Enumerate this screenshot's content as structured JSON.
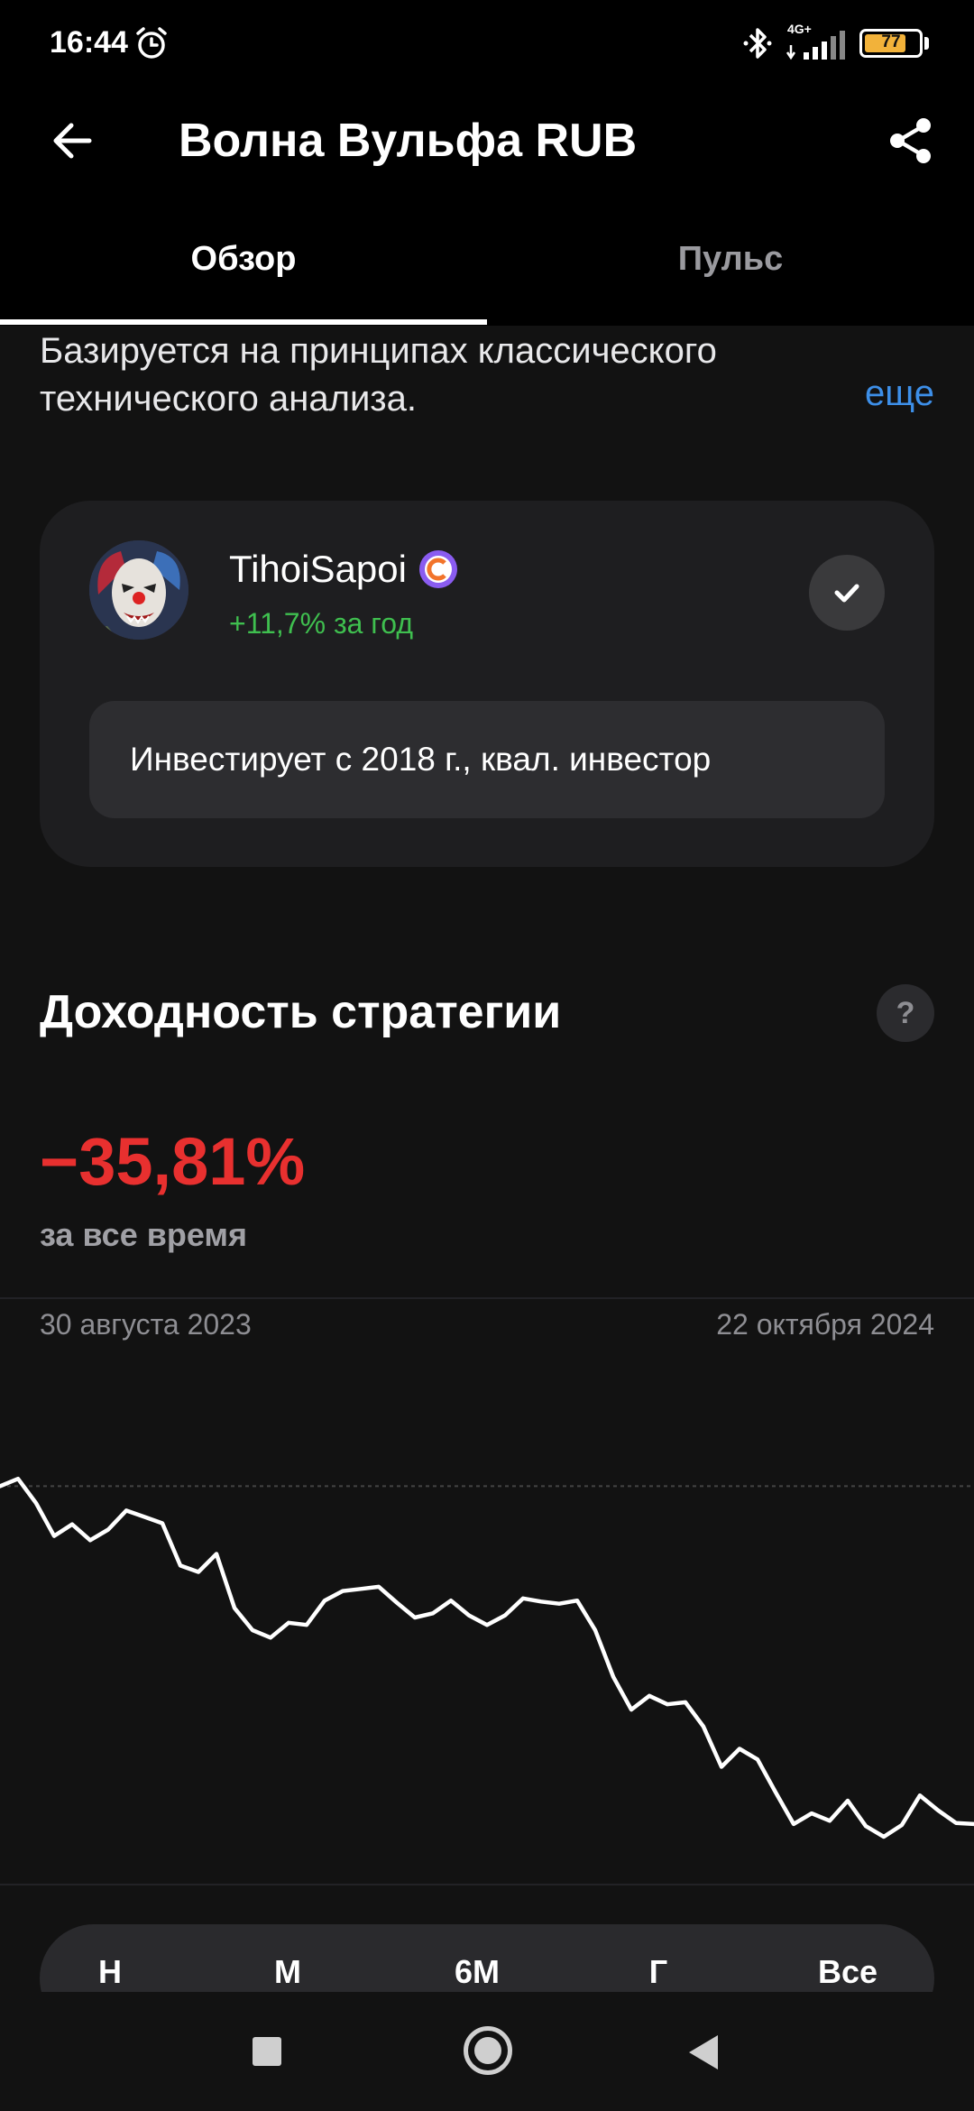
{
  "status_bar": {
    "time": "16:44",
    "network": "4G+",
    "battery_level": "77",
    "battery_fraction": 0.77
  },
  "header": {
    "title": "Волна Вульфа RUB"
  },
  "tabs": [
    {
      "label": "Обзор",
      "active": true
    },
    {
      "label": "Пульс",
      "active": false
    }
  ],
  "description": {
    "text": "Базируется на принципах классического технического анализа.",
    "more_label": "еще"
  },
  "author": {
    "name": "TihoiSapoi",
    "badge_icon": "verified-c-icon",
    "yearly_return": "+11,7% за год",
    "bio": "Инвестирует с 2018 г., квал. инвестор",
    "subscribed": true
  },
  "performance": {
    "title": "Доходность стратегии",
    "help_label": "?",
    "value": "−35,81%",
    "caption": "за все время"
  },
  "chart_data": {
    "type": "line",
    "x_start_label": "30 августа 2023",
    "x_end_label": "22 октября 2024",
    "reference_line": 0,
    "ylim": [
      -36,
      10
    ],
    "series": [
      {
        "values": [
          0,
          0.7,
          -1.6,
          -4.7,
          -3.6,
          -5.1,
          -4.1,
          -2.3,
          -2.9,
          -3.5,
          -7.5,
          -8.1,
          -6.4,
          -11.5,
          -13.6,
          -14.3,
          -12.9,
          -13.1,
          -10.8,
          -9.9,
          -9.7,
          -9.5,
          -11.0,
          -12.4,
          -12.0,
          -10.8,
          -12.2,
          -13.1,
          -12.2,
          -10.6,
          -10.9,
          -11.1,
          -10.8,
          -13.6,
          -18.0,
          -21.1,
          -19.8,
          -20.6,
          -20.4,
          -22.7,
          -26.5,
          -24.8,
          -25.8,
          -28.9,
          -31.9,
          -30.9,
          -31.6,
          -29.7,
          -32.1,
          -33.1,
          -32.0,
          -29.2,
          -30.6,
          -31.8,
          -31.9
        ]
      }
    ],
    "line_color": "#ffffff"
  },
  "periods": [
    "Н",
    "М",
    "6М",
    "Г",
    "Все"
  ],
  "icons": {
    "back": "arrow-left-icon",
    "share": "share-icon",
    "subscribed": "checkmark-icon",
    "alarm": "alarm-icon",
    "bluetooth": "bluetooth-icon",
    "signal": "signal-icon",
    "battery": "battery-icon"
  },
  "colors": {
    "background": "#121212",
    "header": "#000000",
    "card": "#1e1e20",
    "negative": "#e8302f",
    "positive": "#3fbf4f",
    "link": "#3d8fe8",
    "badge": "#8a5cf0"
  }
}
